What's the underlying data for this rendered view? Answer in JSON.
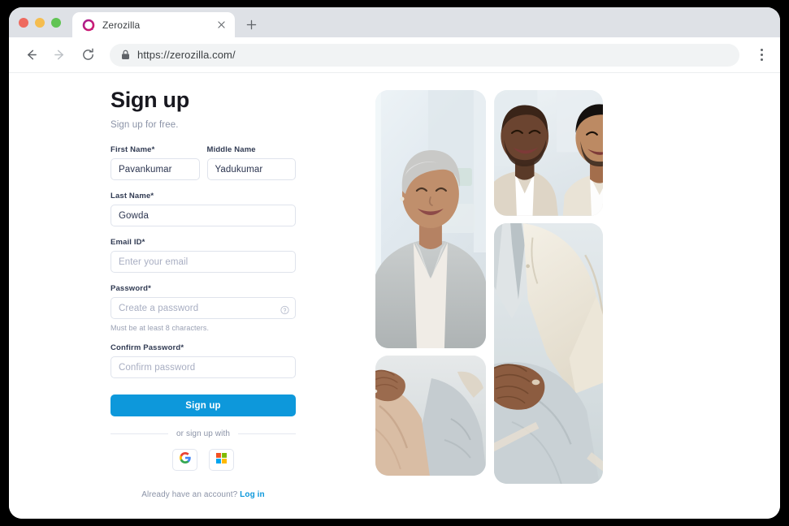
{
  "browser": {
    "tab": {
      "title": "Zerozilla",
      "favicon_name": "zerozilla-logo-icon",
      "close_label": "×"
    },
    "new_tab_label": "+",
    "back_label": "←",
    "forward_label": "→",
    "reload_label": "↻",
    "url": "https://zerozilla.com/",
    "lock_name": "lock-icon",
    "menu_name": "browser-menu-icon",
    "traffic_lights": [
      "close",
      "minimize",
      "maximize"
    ],
    "colors": {
      "tabstrip": "#dee1e6",
      "omnibox": "#f1f3f4",
      "red": "#ee6a5f",
      "yellow": "#f5bd4f",
      "green": "#61c454"
    }
  },
  "signup": {
    "title": "Sign up",
    "subtitle": "Sign up for free.",
    "fields": {
      "first_name": {
        "label": "First Name*",
        "value": "Pavankumar",
        "placeholder": ""
      },
      "middle_name": {
        "label": "Middle Name",
        "value": "Yadukumar",
        "placeholder": ""
      },
      "last_name": {
        "label": "Last Name*",
        "value": "Gowda",
        "placeholder": ""
      },
      "email": {
        "label": "Email ID*",
        "value": "",
        "placeholder": "Enter your email"
      },
      "password": {
        "label": "Password*",
        "value": "",
        "placeholder": "Create a password",
        "hint": "Must be at least 8 characters.",
        "icon_name": "help-circle-icon"
      },
      "confirm": {
        "label": "Confirm Password*",
        "value": "",
        "placeholder": "Confirm password"
      }
    },
    "submit_label": "Sign up",
    "divider_text": "or sign up with",
    "social": [
      {
        "name": "google",
        "label": "Google"
      },
      {
        "name": "microsoft",
        "label": "Microsoft"
      }
    ],
    "footer_text": "Already have an account?",
    "footer_link": "Log in",
    "accent_color": "#0d98db",
    "title_color": "#18181f"
  },
  "collage": {
    "photos": [
      {
        "name": "photo-smiling-woman-grey-blazer",
        "alt": "Smiling woman in grey blazer"
      },
      {
        "name": "photo-two-smiling-men",
        "alt": "Two smiling men in suits"
      },
      {
        "name": "photo-seated-laps-hands",
        "alt": "Seated people hands on laps"
      },
      {
        "name": "photo-man-cream-blazer-hands",
        "alt": "Man in cream blazer with clasped hands"
      }
    ]
  }
}
